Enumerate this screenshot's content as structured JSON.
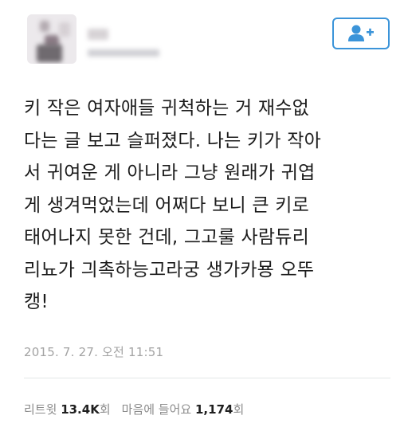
{
  "tweet": {
    "text_lines": [
      "키 작은 여자애들 귀척하는 거 재수없",
      "다는 글 보고 슬퍼졌다. 나는 키가 작아",
      "서 귀여운 게 아니라 그냥 원래가 귀엽",
      "게 생겨먹었는데 어쩌다 보니 큰 키로",
      "태어나지 못한 건데, 그고룰 사람듀리",
      "리뇨가 긔촉하능고라궁 생가카묭 오뚜",
      "캥!"
    ],
    "timestamp": "2015. 7. 27. 오전 11:51"
  },
  "header": {
    "follow_icon": "add-user-icon"
  },
  "stats": {
    "retweet_label": "리트윗",
    "retweet_count": "13.4K",
    "retweet_unit": "회",
    "likes_label": "마음에 들어요",
    "likes_count": "1,174",
    "likes_unit": "회"
  },
  "colors": {
    "accent": "#3b94d9",
    "timestamp": "#a3a3a3",
    "divider": "#e3e6e8"
  }
}
